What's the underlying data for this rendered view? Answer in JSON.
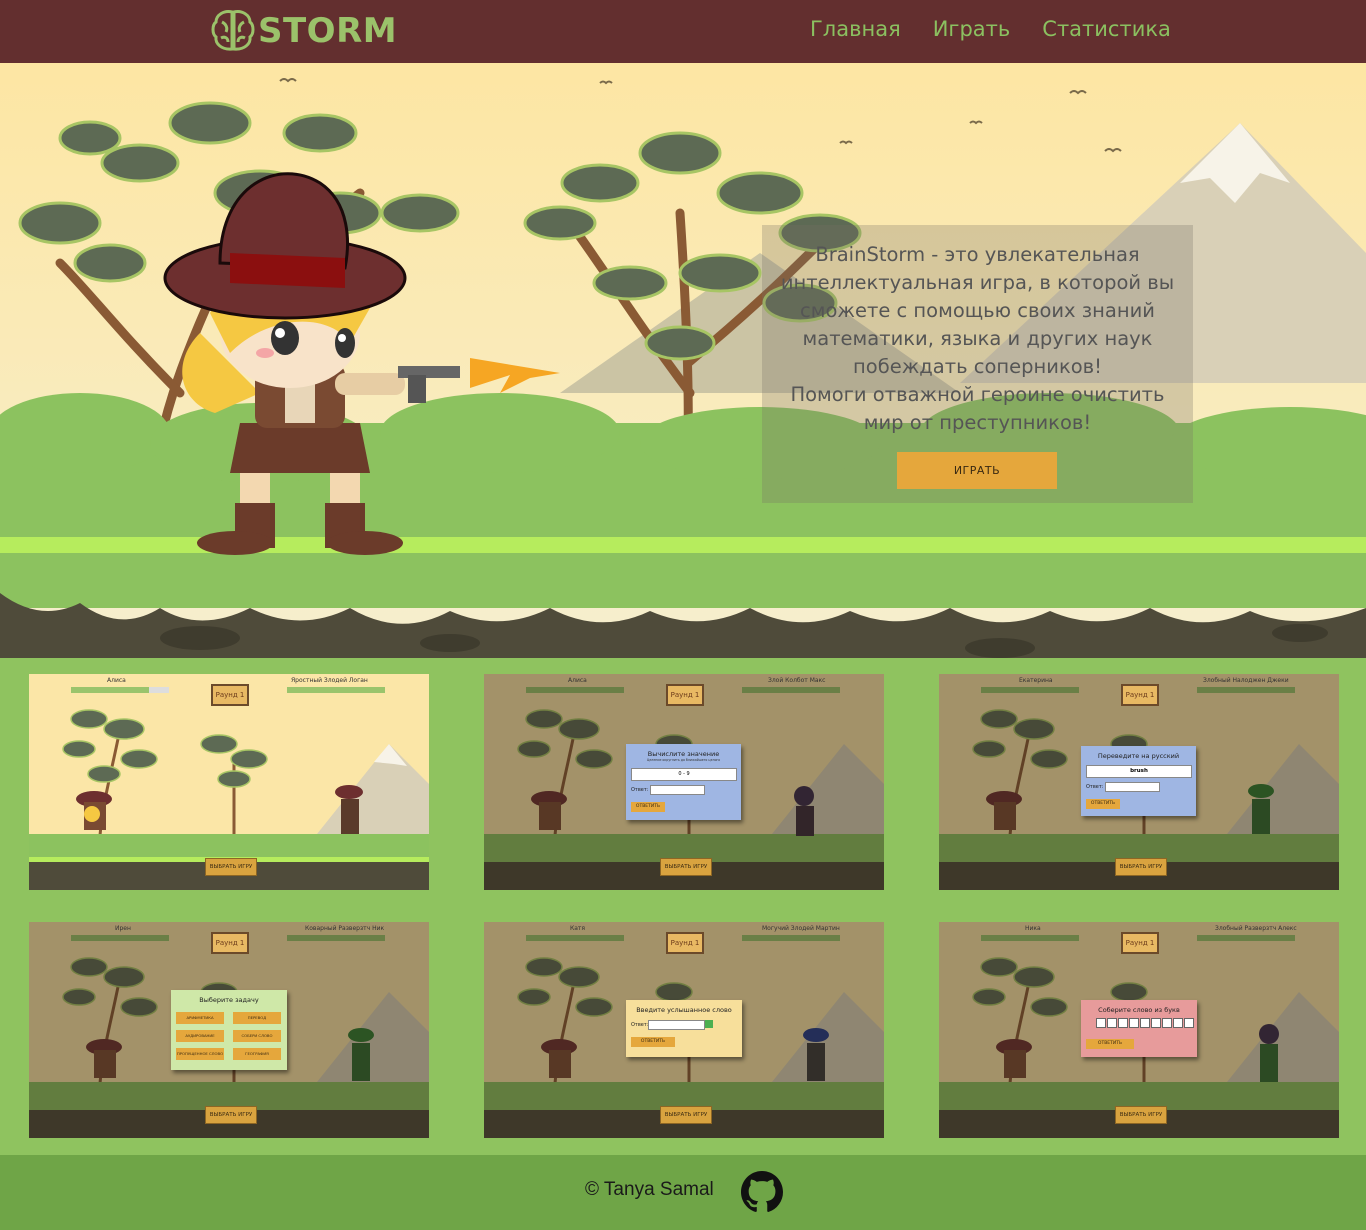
{
  "header": {
    "logo_text": "STORM",
    "nav": [
      "Главная",
      "Играть",
      "Статистика"
    ]
  },
  "hero": {
    "description_lines": [
      "BrainStorm - это увлекательная",
      "интеллектуальная игра, в которой вы",
      "сможете с помощью своих знаний",
      "математики, языка и других наук",
      "побеждать соперников!",
      "Помоги отважной героине очистить",
      "мир от преступников!"
    ],
    "button_label": "ИГРАТЬ"
  },
  "gallery": [
    {
      "player": "Алиса",
      "enemy": "Яростный Злодей Логан",
      "round": "Раунд 1",
      "button": "ВЫБРАТЬ ИГРУ"
    },
    {
      "player": "Алиса",
      "enemy": "Злой Колбот Макс",
      "round": "Раунд 1",
      "button": "ВЫБРАТЬ ИГРУ",
      "modal": {
        "title": "Вычислите значение",
        "subtitle": "Целение округлить до ближайшего целого",
        "expression": "0 - 9",
        "answer_label": "Ответ:",
        "button": "ОТВЕТИТЬ"
      }
    },
    {
      "player": "Екатерина",
      "enemy": "Злобный Налоджен Джеки",
      "round": "Раунд 1",
      "button": "ВЫБРАТЬ ИГРУ",
      "modal": {
        "title": "Переведите на русский",
        "word": "brush",
        "answer_label": "Ответ:",
        "button": "ОТВЕТИТЬ"
      }
    },
    {
      "player": "Ирен",
      "enemy": "Коварный Разверзтч Ник",
      "round": "Раунд 1",
      "button": "ВЫБРАТЬ ИГРУ",
      "modal": {
        "title": "Выберите задачу",
        "tasks": [
          "АРИФМЕТИКА",
          "ПЕРЕВОД",
          "АУДИРОВАНИЕ",
          "СОБЕРИ СЛОВО",
          "ПРОПУЩЕННОЕ СЛОВО",
          "ГЕОГРАФИЯ"
        ]
      }
    },
    {
      "player": "Катя",
      "enemy": "Могучий Злодей Мартин",
      "round": "Раунд 1",
      "button": "ВЫБРАТЬ ИГРУ",
      "modal": {
        "title": "Введите услышанное слово",
        "answer_label": "Ответ:",
        "button": "ОТВЕТИТЬ"
      }
    },
    {
      "player": "Ника",
      "enemy": "Злобный Разверзтч Алекс",
      "round": "Раунд 1",
      "button": "ВЫБРАТЬ ИГРУ",
      "modal": {
        "title": "Соберите слово из букв",
        "button": "ОТВЕТИТЬ"
      }
    }
  ],
  "footer": {
    "copyright": "© Tanya Samal"
  },
  "colors": {
    "header_bg": "#632f2f",
    "nav": "#8bc060",
    "accent": "#e5a73c",
    "page_bg": "#8fc35f",
    "footer_bg": "#6fa547"
  },
  "icons": [
    "brain-logo-icon",
    "github-icon"
  ]
}
